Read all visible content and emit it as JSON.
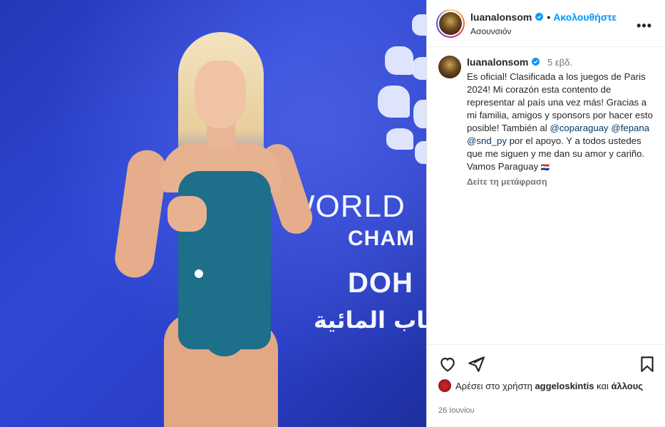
{
  "post": {
    "username": "luanalonsom",
    "follow_label": "Ακολουθήστε",
    "location": "Ασουνσιόν",
    "more_label": "•••"
  },
  "media": {
    "backdrop_line1": "WORLD",
    "backdrop_line2": "CHAM",
    "backdrop_line3": "DOH",
    "backdrop_line4": "ـاب المائية"
  },
  "caption": {
    "username": "luanalonsom",
    "time_ago": "5 εβδ.",
    "text_before_mentions": "Es oficial! Clasificada a los juegos de Paris 2024! Mi corazón esta contento de representar al país una vez más! Gracias a mi familia, amigos y sponsors por hacer esto posible! También al ",
    "mention1": "@coparaguay",
    "mention2": "@fepana",
    "mention3": "@snd_py",
    "text_after_mentions": " por el apoyo. Y a todos ustedes que me siguen y me dan su amor y cariño. Vamos Paraguay ",
    "flag_text": "🇵🇾",
    "translate_label": "Δείτε τη μετάφραση"
  },
  "likes": {
    "prefix": "Αρέσει στο χρήστη ",
    "user": "aggeloskintis",
    "and": " και ",
    "others": "άλλους"
  },
  "date": "26 Ιουνίου",
  "colors": {
    "accent": "#0095f6",
    "mention": "#00376b",
    "muted": "#737373"
  }
}
